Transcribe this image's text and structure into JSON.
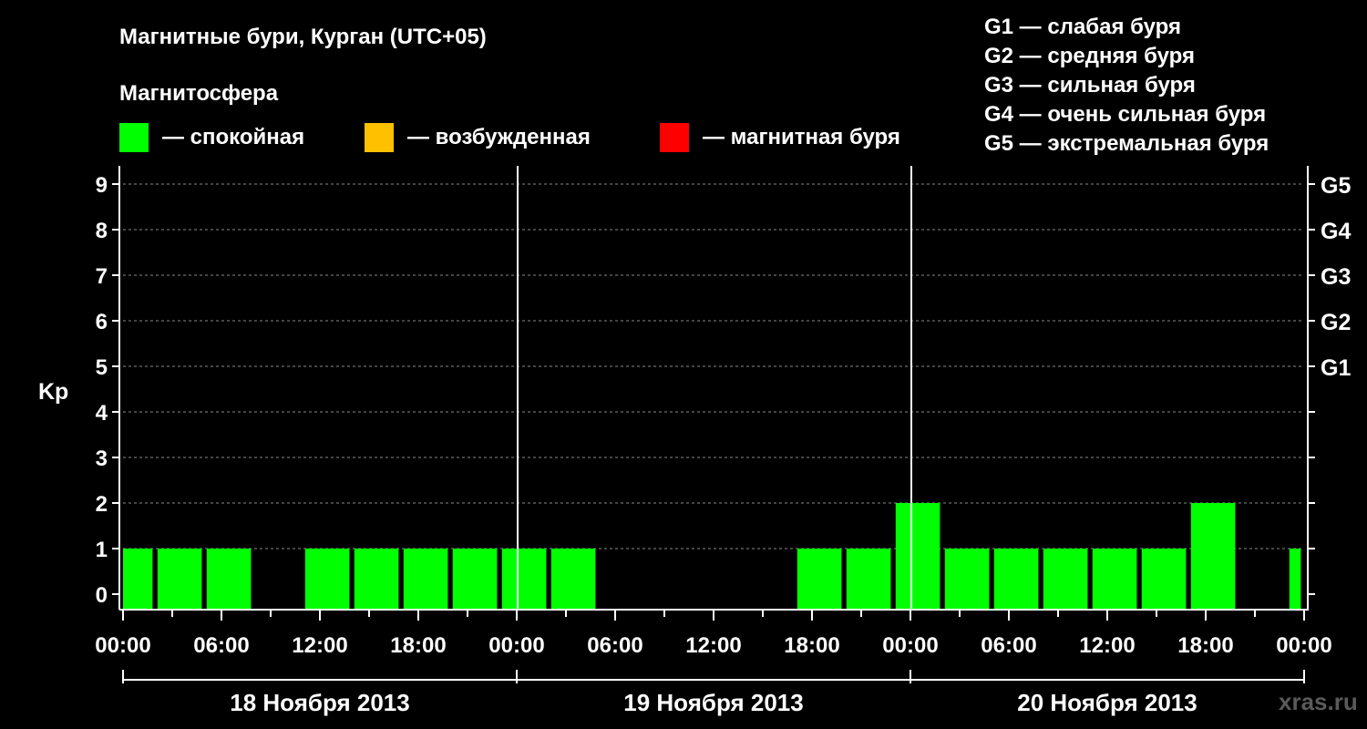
{
  "chart_data": {
    "type": "bar",
    "title": "Магнитные бури, Курган (UTC+05)",
    "legend_title": "Магнитосфера",
    "legend": [
      {
        "label": "— спокойная",
        "color": "#00ff00"
      },
      {
        "label": "— возбужденная",
        "color": "#ffc000"
      },
      {
        "label": "— магнитная буря",
        "color": "#ff0000"
      }
    ],
    "storm_scale": [
      "G1 — слабая буря",
      "G2 — средняя буря",
      "G3 — сильная буря",
      "G4 — очень сильная буря",
      "G5 — экстремальная буря"
    ],
    "ylabel": "Kp",
    "ylim": [
      0,
      9
    ],
    "yticks": [
      "0",
      "1",
      "2",
      "3",
      "4",
      "5",
      "6",
      "7",
      "8",
      "9"
    ],
    "right_labels": [
      {
        "kp": 5,
        "label": "G1"
      },
      {
        "kp": 6,
        "label": "G2"
      },
      {
        "kp": 7,
        "label": "G3"
      },
      {
        "kp": 8,
        "label": "G4"
      },
      {
        "kp": 9,
        "label": "G5"
      }
    ],
    "x_hours_total": 72,
    "xtick_labels": [
      "00:00",
      "06:00",
      "12:00",
      "18:00",
      "00:00",
      "06:00",
      "12:00",
      "18:00",
      "00:00",
      "06:00",
      "12:00",
      "18:00",
      "00:00"
    ],
    "days": [
      "18 Ноября 2013",
      "19 Ноября 2013",
      "20 Ноября 2013"
    ],
    "bar_color": "#00ff00",
    "bars": [
      {
        "start": 0,
        "end": 1.8,
        "kp": 1
      },
      {
        "start": 2.1,
        "end": 4.8,
        "kp": 1
      },
      {
        "start": 5.1,
        "end": 7.8,
        "kp": 1
      },
      {
        "start": 11.1,
        "end": 13.8,
        "kp": 1
      },
      {
        "start": 14.1,
        "end": 16.8,
        "kp": 1
      },
      {
        "start": 17.1,
        "end": 19.8,
        "kp": 1
      },
      {
        "start": 20.1,
        "end": 22.8,
        "kp": 1
      },
      {
        "start": 23.1,
        "end": 25.8,
        "kp": 1
      },
      {
        "start": 26.1,
        "end": 28.8,
        "kp": 1
      },
      {
        "start": 41.1,
        "end": 43.8,
        "kp": 1
      },
      {
        "start": 44.1,
        "end": 46.8,
        "kp": 1
      },
      {
        "start": 47.1,
        "end": 49.8,
        "kp": 2
      },
      {
        "start": 50.1,
        "end": 52.8,
        "kp": 1
      },
      {
        "start": 53.1,
        "end": 55.8,
        "kp": 1
      },
      {
        "start": 56.1,
        "end": 58.8,
        "kp": 1
      },
      {
        "start": 59.1,
        "end": 61.8,
        "kp": 1
      },
      {
        "start": 62.1,
        "end": 64.8,
        "kp": 1
      },
      {
        "start": 65.1,
        "end": 67.8,
        "kp": 2
      },
      {
        "start": 71.1,
        "end": 71.8,
        "kp": 1
      }
    ],
    "grid_dashed": true,
    "watermark": "xras.ru"
  }
}
